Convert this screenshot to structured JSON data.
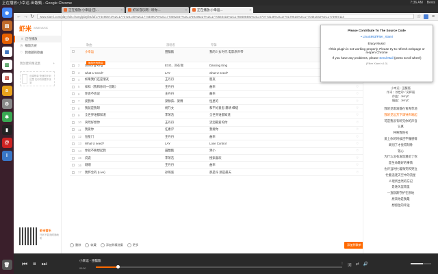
{
  "os": {
    "window_title": "正在播放:小幸运-田馥甄 - Google Chrome",
    "clock": "7:36 AM",
    "user": "Bevis",
    "launcher_icons": [
      "chrome-icon",
      "files-icon",
      "firefox-icon",
      "writer-icon",
      "calc-icon",
      "impress-icon",
      "amazon-icon",
      "settings-icon",
      "terminal-icon",
      "ebook-icon",
      "debian-icon",
      "ide-icon",
      "trash-icon"
    ]
  },
  "browser": {
    "tabs": [
      {
        "label": "正在播放:小幸运-田…",
        "active": false
      },
      {
        "label": "虾米音乐网 - 听你…",
        "active": false
      },
      {
        "label": "正在播放:小幸运…",
        "active": true
      }
    ],
    "url": "www.xiami.com/play?ids=/song/playlist/id/1774490572%2C1770724145%2C1774409076%2C1770592347%2C1769196227%2C1770540415%2C1769489492%2C1770773148%2C1770179610%2C1770461042%2C1773987114"
  },
  "sidebar": {
    "brand": "虾米",
    "brand_sub": "XIAMI MUSIC",
    "items": [
      {
        "icon": "list-icon",
        "label": "正在播放",
        "active": true
      },
      {
        "icon": "clock-icon",
        "label": "播放历史",
        "active": false
      },
      {
        "icon": "heart-icon",
        "label": "我收藏的歌曲",
        "active": false
      }
    ],
    "section_title": "我创建的精选集",
    "section_add": "+",
    "empty_text": "创建歌单 快速同步到这里 在你的收藏中找到",
    "qr_brand": "虾米音乐",
    "qr_sub": "扫码下载 随时随地听"
  },
  "table": {
    "headers": [
      "歌曲",
      "演唱者",
      "专辑"
    ],
    "rows": [
      {
        "no": "",
        "song": "小幸运",
        "artist": "田馥甄",
        "album": "我的少女时代 电影原声带",
        "playing": true
      },
      {
        "no": "2",
        "song": "Dancing King",
        "artist": "EXO、刘在锡",
        "album": "Dancing King"
      },
      {
        "no": "3",
        "song": "what U need?",
        "artist": "LAY",
        "album": "what U need?"
      },
      {
        "no": "4",
        "song": "如果我们还是朋友",
        "artist": "王丹丹",
        "album": "朋友"
      },
      {
        "no": "5",
        "song": "样样（我和你同一首歌）",
        "artist": "王丹丹",
        "album": "曲率"
      },
      {
        "no": "6",
        "song": "你会不会说",
        "artist": "王丹丹",
        "album": "曲率"
      },
      {
        "no": "7",
        "song": "爱我事",
        "artist": "梁静茹、梁博",
        "album": "恒星的"
      },
      {
        "no": "8",
        "song": "我就是我呀",
        "artist": "杨乃文",
        "album": "和不好意思 暴晴 细缝"
      },
      {
        "no": "9",
        "song": "全世界谁都知道",
        "artist": "李荣浩",
        "album": "全世界谁都知道"
      },
      {
        "no": "10",
        "song": "突然好想你",
        "artist": "王丹丹",
        "album": "流泪最爱的你"
      },
      {
        "no": "11",
        "song": "我爱你",
        "artist": "任素汐",
        "album": "我要你"
      },
      {
        "no": "12",
        "song": "恒星门",
        "artist": "王丹丹",
        "album": "曲率"
      },
      {
        "no": "13",
        "song": "What U need?",
        "artist": "LAY",
        "album": "Lose Control"
      },
      {
        "no": "14",
        "song": "你就不要想起我",
        "artist": "田馥甄",
        "album": "渺小"
      },
      {
        "no": "15",
        "song": "说说",
        "artist": "李荣浩",
        "album": "搜索喜欢"
      },
      {
        "no": "16",
        "song": "刚刚",
        "artist": "王丹丹",
        "album": "曲率"
      },
      {
        "no": "17",
        "song": "我怀念的 (Live)",
        "artist": "孙燕姿",
        "album": "那是许 那是最天"
      }
    ],
    "play_label": "播放所有歌曲"
  },
  "footer": {
    "delete": "删除",
    "collect": "收藏",
    "add_to": "添加到精选集",
    "more": "更多",
    "primary": "添加到歌单"
  },
  "right_panel": {
    "song_title": "小幸运 - 田馥甄",
    "info_lines": [
      "作词：徐世珍 / 吴辉福",
      "作曲：JerryC",
      "编曲：JerryC"
    ],
    "lyrics": [
      {
        "text": "我听见雨滴落在青青草地",
        "hl": false
      },
      {
        "text": "我听见远方下课钟声响起",
        "hl": true
      },
      {
        "text": "可是我没有听见你的声音",
        "hl": false
      },
      {
        "text": "认真",
        "hl": false
      },
      {
        "text": "呼唤我姓名",
        "hl": false
      },
      {
        "text": "爱上你的时候还不懂感情",
        "hl": false
      },
      {
        "text": "离别了才觉得刻骨",
        "hl": false
      },
      {
        "text": "铭心",
        "hl": false
      },
      {
        "text": "为什么没有发现遇见了你",
        "hl": false
      },
      {
        "text": "是生命最好的事情",
        "hl": false
      },
      {
        "text": "也许当时忙着微笑和哭泣",
        "hl": false
      },
      {
        "text": "忙着追逐天空中的流星",
        "hl": false
      },
      {
        "text": "人理所当然的忘记",
        "hl": false
      },
      {
        "text": "是谁风里雨里",
        "hl": false
      },
      {
        "text": "一直默默守护在原地",
        "hl": false
      },
      {
        "text": "原来你是我最",
        "hl": false
      },
      {
        "text": "想留住的幸运",
        "hl": false
      }
    ]
  },
  "popup": {
    "title": "Please Contribute To The Source Code",
    "link": "• LinuS993/Fiter_Xiami",
    "line1": "Enjoy Music!",
    "line2": "If this plugin is not working properly, Please try to refresh webpage or reopen Chrome",
    "line3_pre": "If you have any problems, please",
    "line3_link": "Send Mail",
    "line3_post": "(press scroll wheel)",
    "version": "(Filter Xiami v1.0)"
  },
  "player": {
    "track": "小幸运 - 田馥甄",
    "time": "00:00",
    "progress": 0.09,
    "volume": 0.6
  },
  "colors": {
    "accent": "#ff6a00",
    "launcher_bg": "#3a1f2b",
    "player_bg": "#2a2a2a"
  }
}
